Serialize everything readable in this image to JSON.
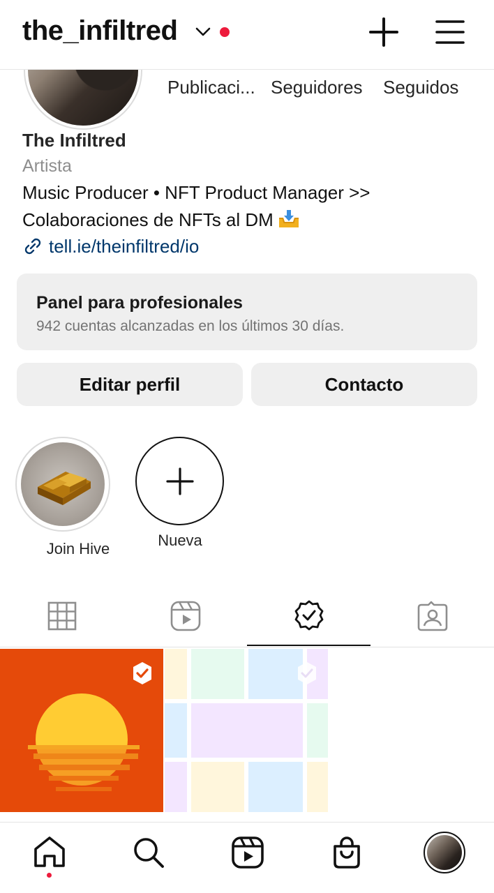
{
  "header": {
    "username": "the_infiltred",
    "notification_color": "#ed1b3c"
  },
  "profile": {
    "stats": {
      "posts_label": "Publicaci...",
      "followers_label": "Seguidores",
      "following_label": "Seguidos"
    },
    "display_name": "The Infiltred",
    "category": "Artista",
    "bio_line1": "Music Producer • NFT Product Manager >>",
    "bio_line2": "Colaboraciones de NFTs al DM",
    "bio_emoji": "inbox-tray-emoji",
    "link": "tell.ie/theinfiltred/io"
  },
  "pro_panel": {
    "title": "Panel para profesionales",
    "subtitle": "942 cuentas alcanzadas en los últimos 30 días."
  },
  "buttons": {
    "edit": "Editar perfil",
    "contact": "Contacto"
  },
  "highlights": [
    {
      "label": "Join Hive"
    },
    {
      "label": "Nueva"
    }
  ],
  "tabs": [
    {
      "name": "grid-icon",
      "active": false
    },
    {
      "name": "reels-icon",
      "active": false
    },
    {
      "name": "collab-icon",
      "active": true
    },
    {
      "name": "tagged-icon",
      "active": false
    }
  ],
  "bottom_nav": [
    {
      "name": "home-icon",
      "active": true
    },
    {
      "name": "search-icon"
    },
    {
      "name": "reels-icon"
    },
    {
      "name": "shop-icon"
    },
    {
      "name": "profile-avatar"
    }
  ],
  "colors": {
    "link": "#00376b",
    "accent_red": "#ed1b3c",
    "panel_bg": "#efefef"
  }
}
